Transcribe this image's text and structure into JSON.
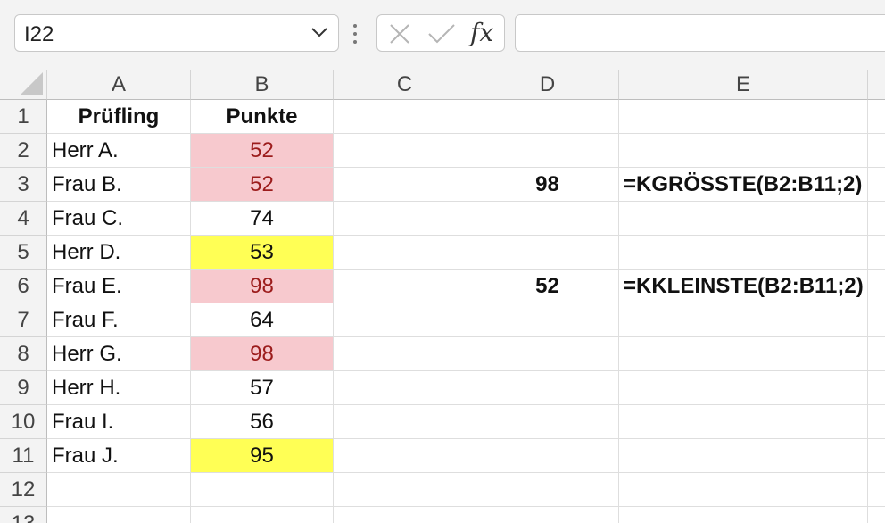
{
  "formula_bar": {
    "name_box": "I22",
    "formula": "",
    "fx_label": "fx"
  },
  "columns": [
    "A",
    "B",
    "C",
    "D",
    "E"
  ],
  "rows": [
    "1",
    "2",
    "3",
    "4",
    "5",
    "6",
    "7",
    "8",
    "9",
    "10",
    "11",
    "12",
    "13"
  ],
  "cells": {
    "A1": "Prüfling",
    "B1": "Punkte",
    "A2": "Herr A.",
    "B2": "52",
    "A3": "Frau B.",
    "B3": "52",
    "D3": "98",
    "E3": "=KGRÖSSTE(B2:B11;2)",
    "A4": "Frau C.",
    "B4": "74",
    "A5": "Herr D.",
    "B5": "53",
    "A6": "Frau E.",
    "B6": "98",
    "D6": "52",
    "E6": "=KKLEINSTE(B2:B11;2)",
    "A7": "Frau F.",
    "B7": "64",
    "A8": "Herr G.",
    "B8": "98",
    "A9": "Herr H.",
    "B9": "57",
    "A10": "Frau I.",
    "B10": "56",
    "A11": "Frau J.",
    "B11": "95"
  },
  "highlight_colors": {
    "duplicate_fill": "#f7c9ce",
    "duplicate_text": "#9c1c1c",
    "unique_fill": "#ffff55"
  }
}
